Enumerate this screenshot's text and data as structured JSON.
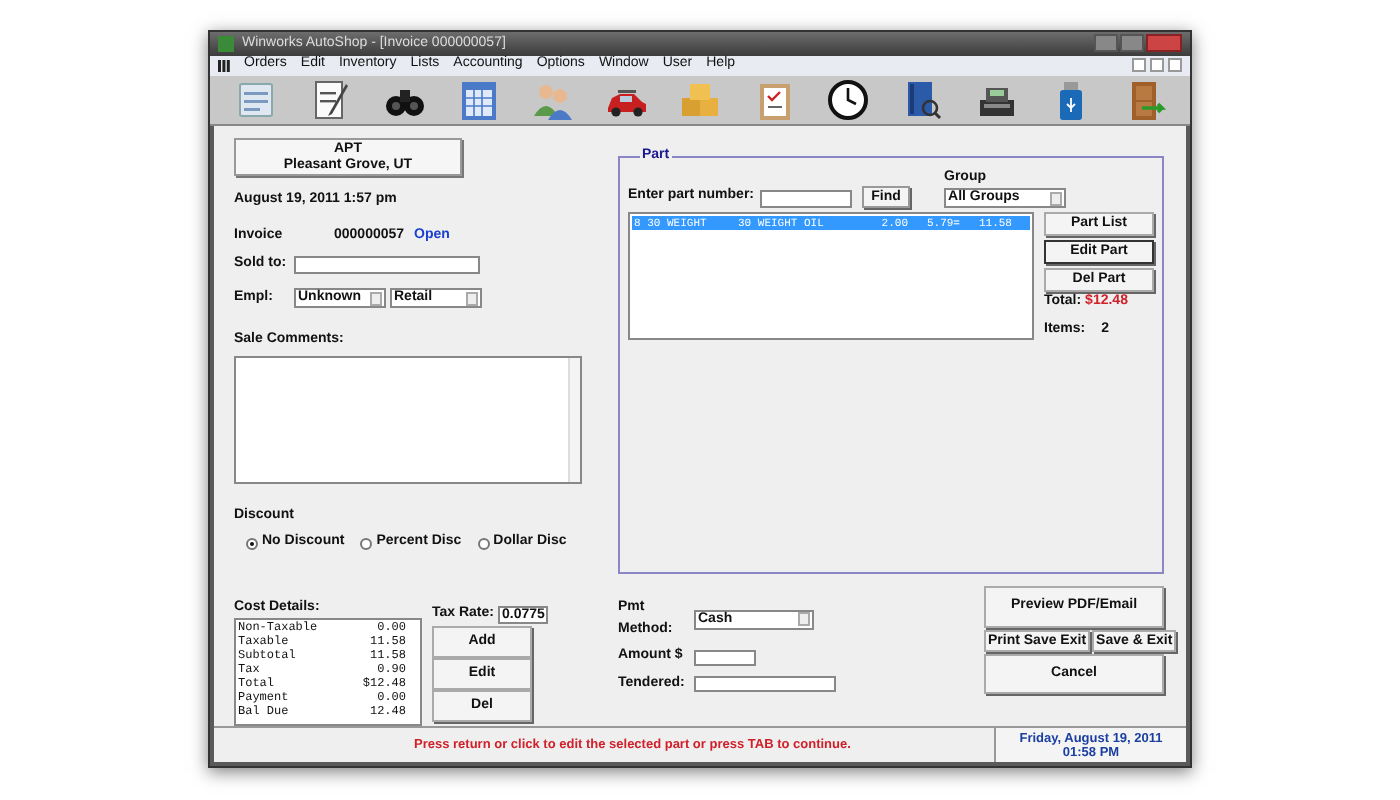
{
  "window": {
    "title": "Winworks AutoShop - [Invoice 000000057]"
  },
  "menu": [
    "Orders",
    "Edit",
    "Inventory",
    "Lists",
    "Accounting",
    "Options",
    "Window",
    "User",
    "Help"
  ],
  "toolbar": [
    {
      "kind": "notes"
    },
    {
      "kind": "notepad"
    },
    {
      "kind": "binoculars"
    },
    {
      "kind": "calendar"
    },
    {
      "kind": "people"
    },
    {
      "kind": "car"
    },
    {
      "kind": "boxes"
    },
    {
      "kind": "clipboard"
    },
    {
      "kind": "clock"
    },
    {
      "kind": "help"
    },
    {
      "kind": "register"
    },
    {
      "kind": "usb"
    },
    {
      "kind": "door"
    }
  ],
  "store": {
    "name": "APT",
    "location": "Pleasant Grove, UT"
  },
  "date": "August 19, 2011 1:57 pm",
  "invoice": {
    "label": "Invoice",
    "number": "000000057",
    "status": "Open"
  },
  "sold_to": {
    "label": "Sold to:"
  },
  "employee": {
    "label": "Empl:",
    "selects": [
      "Unknown",
      "Retail"
    ]
  },
  "comments": {
    "label": "Sale Comments:"
  },
  "discount": {
    "label": "Discount",
    "options": [
      {
        "label": "No Discount",
        "selected": true
      },
      {
        "label": "Percent Disc",
        "selected": false
      },
      {
        "label": "Dollar Disc",
        "selected": false
      }
    ]
  },
  "cost_details": {
    "label": "Cost Details:",
    "rows": [
      {
        "name": "Non-Taxable",
        "value": "0.00"
      },
      {
        "name": "Taxable",
        "value": "11.58"
      },
      {
        "name": "Subtotal",
        "value": "11.58"
      },
      {
        "name": "Tax",
        "value": "0.90"
      },
      {
        "name": "Total",
        "value": "$12.48"
      },
      {
        "name": "Payment",
        "value": "0.00"
      },
      {
        "name": "Bal Due",
        "value": "12.48"
      }
    ]
  },
  "tax_rate": {
    "label": "Tax Rate:",
    "value": "0.0775"
  },
  "cost_buttons": [
    "Add",
    "Edit",
    "Del"
  ],
  "part": {
    "title": "Part",
    "search_label": "Enter part number:",
    "find": "Find",
    "group_label": "Group",
    "group": "All Groups",
    "rows": [
      {
        "cells": [
          "8 30 WEIGHT",
          "30 WEIGHT OIL",
          "2.00",
          "5.79=",
          "11.58"
        ],
        "selected": true
      }
    ],
    "buttons": [
      "Part List",
      "Edit Part",
      "Del Part"
    ],
    "total_label": "Total:",
    "total": "$12.48",
    "items_label": "Items:",
    "items": "2"
  },
  "payment": {
    "method_label": "Pmt Method:",
    "method": "Cash",
    "amount_label": "Amount $",
    "tendered_label": "Tendered:"
  },
  "actions": [
    "Preview PDF/Email",
    "Print Save Exit",
    "Save & Exit",
    "Cancel"
  ],
  "status_bar": {
    "message": "Press return or click to edit the selected part or press TAB to continue.",
    "date": "Friday, August 19, 2011",
    "time": "01:58 PM"
  }
}
